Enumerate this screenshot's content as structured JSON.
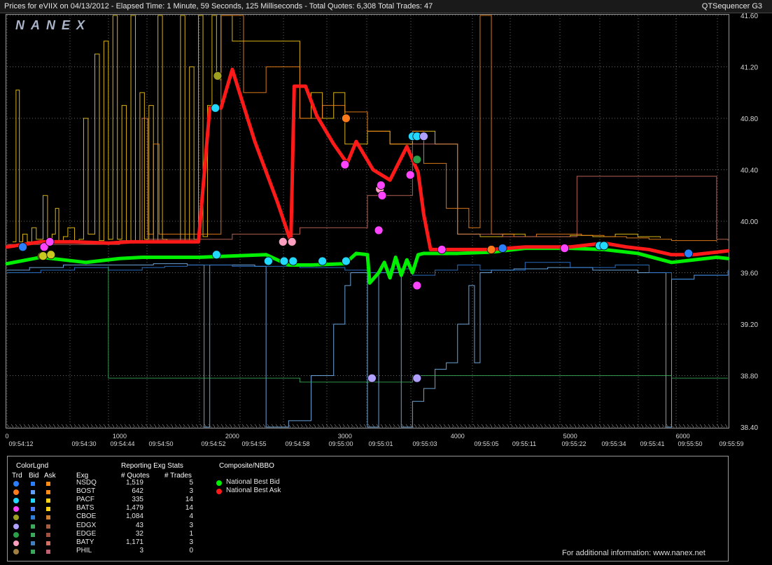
{
  "header": {
    "title": "Prices for  eVIIX  on  04/13/2012  -  Elapsed Time: 1 Minute, 59 Seconds, 125 Milliseconds  -  Total Quotes: 6,308  Total Trades: 47",
    "product": "QTSequencer G3",
    "watermark": "NANEX"
  },
  "chart_data": {
    "type": "line",
    "title": "",
    "ylim": [
      38.4,
      41.6
    ],
    "y_ticks": [
      "41.60",
      "41.20",
      "40.80",
      "40.40",
      "40.00",
      "39.60",
      "39.20",
      "38.80",
      "38.40"
    ],
    "xlim": [
      0,
      6400
    ],
    "x_ticks": [
      "0",
      "1000",
      "2000",
      "3000",
      "4000",
      "5000",
      "6000"
    ],
    "time_labels": [
      "09:54:12",
      "09:54:30",
      "09:54:44",
      "09:54:50",
      "09:54:52",
      "09:54:55",
      "09:54:58",
      "09:55:00",
      "09:55:01",
      "09:55:03",
      "09:55:05",
      "09:55:11",
      "09:55:22",
      "09:55:34",
      "09:55:41",
      "09:55:50",
      "09:55:59"
    ],
    "grid": true,
    "series": [
      {
        "name": "National Best Bid",
        "color": "#00ee00",
        "x": [
          0,
          300,
          700,
          1000,
          1200,
          1400,
          1700,
          2000,
          2300,
          2500,
          2700,
          3000,
          3100,
          3200,
          3220,
          3300,
          3350,
          3400,
          3450,
          3500,
          3550,
          3600,
          3650,
          3700,
          3800,
          4000,
          4300,
          4600,
          5000,
          5300,
          5600,
          5900,
          6100,
          6300,
          6400
        ],
        "y": [
          39.67,
          39.72,
          39.68,
          39.71,
          39.72,
          39.72,
          39.72,
          39.73,
          39.74,
          39.66,
          39.66,
          39.67,
          39.75,
          39.74,
          39.52,
          39.6,
          39.68,
          39.56,
          39.72,
          39.58,
          39.7,
          39.6,
          39.74,
          39.75,
          39.75,
          39.75,
          39.76,
          39.79,
          39.79,
          39.78,
          39.75,
          39.68,
          39.7,
          39.72,
          39.71
        ]
      },
      {
        "name": "National Best Ask",
        "color": "#ff1a1a",
        "x": [
          0,
          300,
          600,
          900,
          1100,
          1400,
          1700,
          1800,
          1900,
          2000,
          2200,
          2400,
          2520,
          2550,
          2650,
          2750,
          2900,
          3020,
          3100,
          3250,
          3400,
          3550,
          3650,
          3700,
          3760,
          3800,
          3900,
          4300,
          4600,
          5000,
          5300,
          5500,
          5700,
          5900,
          6100,
          6300,
          6400
        ],
        "y": [
          39.8,
          39.84,
          39.84,
          39.83,
          39.84,
          39.84,
          39.84,
          40.88,
          40.88,
          41.18,
          40.62,
          40.15,
          39.84,
          41.05,
          41.05,
          40.82,
          40.6,
          40.45,
          40.62,
          40.4,
          40.32,
          40.58,
          40.38,
          40.05,
          39.78,
          39.78,
          39.78,
          39.78,
          39.8,
          39.8,
          39.83,
          39.8,
          39.78,
          39.74,
          39.74,
          39.76,
          39.77
        ]
      }
    ],
    "trade_markers": [
      {
        "x": 140,
        "y": 39.8,
        "color": "#2a7fff"
      },
      {
        "x": 310,
        "y": 39.73,
        "color": "#c8c820"
      },
      {
        "x": 320,
        "y": 39.73,
        "color": "#c8c820"
      },
      {
        "x": 330,
        "y": 39.8,
        "color": "#ff44ff"
      },
      {
        "x": 380,
        "y": 39.84,
        "color": "#ff44ff"
      },
      {
        "x": 390,
        "y": 39.74,
        "color": "#c8c820"
      },
      {
        "x": 1850,
        "y": 40.88,
        "color": "#22d8ff"
      },
      {
        "x": 1870,
        "y": 41.13,
        "color": "#a0a020"
      },
      {
        "x": 1860,
        "y": 39.74,
        "color": "#22d8ff"
      },
      {
        "x": 2320,
        "y": 39.69,
        "color": "#22d8ff"
      },
      {
        "x": 2450,
        "y": 39.84,
        "color": "#ff9fbf"
      },
      {
        "x": 2530,
        "y": 39.84,
        "color": "#ff9fbf"
      },
      {
        "x": 2460,
        "y": 39.69,
        "color": "#22d8ff"
      },
      {
        "x": 2540,
        "y": 39.69,
        "color": "#22d8ff"
      },
      {
        "x": 2800,
        "y": 39.69,
        "color": "#22d8ff"
      },
      {
        "x": 3000,
        "y": 40.44,
        "color": "#ff44ff"
      },
      {
        "x": 3010,
        "y": 40.8,
        "color": "#ff7a1a"
      },
      {
        "x": 3010,
        "y": 39.69,
        "color": "#22d8ff"
      },
      {
        "x": 3240,
        "y": 38.78,
        "color": "#b0a0ff"
      },
      {
        "x": 3300,
        "y": 39.93,
        "color": "#ff44ff"
      },
      {
        "x": 3310,
        "y": 40.25,
        "color": "#ff9fbf"
      },
      {
        "x": 3320,
        "y": 40.28,
        "color": "#ff44ff"
      },
      {
        "x": 3330,
        "y": 40.2,
        "color": "#ff44ff"
      },
      {
        "x": 3580,
        "y": 40.36,
        "color": "#ff44ff"
      },
      {
        "x": 3600,
        "y": 40.66,
        "color": "#22d8ff"
      },
      {
        "x": 3640,
        "y": 40.66,
        "color": "#22d8ff"
      },
      {
        "x": 3640,
        "y": 40.48,
        "color": "#2a9f4a"
      },
      {
        "x": 3700,
        "y": 40.66,
        "color": "#b0a0ff"
      },
      {
        "x": 3640,
        "y": 38.78,
        "color": "#b0a0ff"
      },
      {
        "x": 3640,
        "y": 39.5,
        "color": "#ff44ff"
      },
      {
        "x": 3860,
        "y": 39.78,
        "color": "#ff44ff"
      },
      {
        "x": 4300,
        "y": 39.78,
        "color": "#ff7a1a"
      },
      {
        "x": 4400,
        "y": 39.79,
        "color": "#2a7fff"
      },
      {
        "x": 4950,
        "y": 39.79,
        "color": "#ff44ff"
      },
      {
        "x": 5260,
        "y": 39.81,
        "color": "#22d8ff"
      },
      {
        "x": 5300,
        "y": 39.81,
        "color": "#22d8ff"
      },
      {
        "x": 6050,
        "y": 39.75,
        "color": "#2a7fff"
      }
    ],
    "noise_lines": [
      {
        "color": "#ffd21a",
        "x": [
          50,
          80,
          80,
          110,
          140,
          180,
          220,
          260,
          320,
          360,
          400,
          430,
          460,
          500,
          540,
          600,
          640,
          680,
          720,
          780,
          820,
          860,
          900,
          940,
          980,
          1020,
          1060,
          1100,
          1140,
          1180,
          1220,
          1260,
          1300,
          1340,
          1380,
          1420
        ],
        "y": [
          39.84,
          39.84,
          41.02,
          39.84,
          39.9,
          39.84,
          39.95,
          39.86,
          40.2,
          39.85,
          39.9,
          40.1,
          39.85,
          39.88,
          39.95,
          39.84,
          39.86,
          40.8,
          39.9,
          41.3,
          39.85,
          41.4,
          39.86,
          41.6,
          39.86,
          40.9,
          39.85,
          41.6,
          39.84,
          41.0,
          39.86,
          40.9,
          39.84,
          41.6,
          39.86,
          39.84
        ]
      },
      {
        "color": "#ffd21a",
        "x": [
          1500,
          1540,
          1580,
          1620,
          1660,
          1700,
          1740,
          1780,
          1820,
          1860,
          1900,
          2000,
          2500,
          2600,
          2700,
          2800,
          2900,
          3000,
          3200,
          3400,
          3600,
          3800,
          4000,
          4200,
          4400,
          4600,
          4800,
          5000,
          5200,
          5400,
          5600,
          5800
        ],
        "y": [
          39.85,
          41.6,
          39.85,
          41.2,
          39.86,
          41.6,
          39.88,
          40.9,
          41.6,
          41.1,
          41.6,
          41.4,
          41.4,
          40.8,
          41.0,
          40.8,
          41.0,
          40.6,
          40.7,
          40.6,
          40.7,
          40.6,
          39.9,
          39.88,
          39.9,
          39.88,
          39.88,
          39.89,
          39.88,
          39.9,
          39.88,
          39.87
        ]
      },
      {
        "color": "#ff8c1a",
        "x": [
          1200,
          1250,
          1300,
          1350,
          1900,
          2100,
          2300,
          2500,
          2600,
          2800,
          3000,
          3200,
          3400,
          3600,
          3700,
          3900,
          4100,
          4200,
          4300,
          4500,
          4700,
          4900,
          5100,
          5300,
          5500,
          5700,
          5900,
          6100,
          6300
        ],
        "y": [
          40.8,
          39.9,
          40.6,
          39.9,
          41.6,
          41.0,
          41.2,
          41.2,
          40.8,
          40.9,
          40.85,
          40.7,
          40.6,
          40.7,
          40.45,
          40.1,
          39.95,
          41.6,
          39.9,
          39.88,
          39.9,
          39.9,
          39.89,
          39.88,
          39.87,
          39.86,
          39.85,
          39.85,
          39.84
        ]
      },
      {
        "color": "#d07060",
        "x": [
          0,
          500,
          1000,
          1200,
          1250,
          2000,
          2600,
          3200,
          3600,
          4000,
          4400,
          5000,
          5060,
          5400,
          5800,
          6100,
          6300,
          6400
        ],
        "y": [
          39.82,
          39.82,
          39.85,
          40.8,
          39.86,
          39.9,
          39.95,
          40.2,
          40.6,
          39.9,
          39.88,
          39.88,
          40.35,
          40.35,
          40.35,
          40.35,
          39.86,
          39.85
        ]
      },
      {
        "color": "#7cc0ff",
        "x": [
          0,
          200,
          500,
          900,
          1300,
          1600,
          1750,
          1800,
          2200,
          2300,
          2500,
          2700,
          2900,
          3000,
          3050,
          3200,
          3300,
          3500,
          3600,
          3700,
          3800,
          3900,
          4000,
          4100,
          4150,
          4200,
          4300,
          4500,
          4800,
          5200,
          5600,
          5800,
          5850,
          5900,
          6100,
          6400
        ],
        "y": [
          39.62,
          39.64,
          39.66,
          39.66,
          39.67,
          39.66,
          38.4,
          39.66,
          39.65,
          38.4,
          38.45,
          38.8,
          39.2,
          39.5,
          39.6,
          38.4,
          39.6,
          38.4,
          38.6,
          38.7,
          38.85,
          38.9,
          39.2,
          39.5,
          38.9,
          39.6,
          39.62,
          39.63,
          39.64,
          39.62,
          39.6,
          39.6,
          38.4,
          39.55,
          39.58,
          39.62
        ]
      },
      {
        "color": "#2f7fdf",
        "x": [
          0,
          300,
          600,
          900,
          1200,
          1400,
          1600,
          2000,
          2600,
          3000,
          3200,
          3400,
          3600,
          3800,
          4000,
          4200,
          4600,
          5000,
          5400,
          5700,
          5900,
          6100,
          6400
        ],
        "y": [
          39.6,
          39.62,
          39.64,
          39.62,
          39.64,
          39.65,
          39.66,
          39.65,
          39.64,
          39.62,
          39.6,
          39.63,
          39.58,
          39.62,
          39.66,
          39.62,
          39.68,
          39.64,
          39.66,
          39.6,
          39.55,
          39.58,
          39.62
        ]
      },
      {
        "color": "#3aaa5a",
        "x": [
          900,
          900,
          1600,
          2400,
          2600,
          3300,
          3600,
          4000,
          5900,
          6400
        ],
        "y": [
          39.65,
          38.78,
          38.78,
          38.78,
          38.75,
          38.75,
          38.8,
          38.8,
          38.78,
          38.78
        ]
      }
    ]
  },
  "legend": {
    "colorlgnd_title": "ColorLgnd",
    "col_trd": "Trd",
    "col_bid": "Bid",
    "col_ask": "Ask",
    "col_exg": "Exg",
    "stats_title": "Reporting Exg Stats",
    "col_quotes": "# Quotes",
    "col_trades": "# Trades",
    "nbbo_title": "Composite/NBBO",
    "nbbo_bid": "National Best Bid",
    "nbbo_ask": "National Best Ask",
    "nbbo_bid_color": "#00ee00",
    "nbbo_ask_color": "#ff1a1a",
    "rows": [
      {
        "exg": "NSDQ",
        "quotes": "1,519",
        "trades": "5",
        "trd": "#2a7fff",
        "bid": "#2a7fff",
        "ask": "#ff8c1a"
      },
      {
        "exg": "BOST",
        "quotes": "642",
        "trades": "3",
        "trd": "#ff7a1a",
        "bid": "#5fa0ff",
        "ask": "#ff8c1a"
      },
      {
        "exg": "PACF",
        "quotes": "335",
        "trades": "14",
        "trd": "#22d8ff",
        "bid": "#22d8ff",
        "ask": "#ffd21a"
      },
      {
        "exg": "BATS",
        "quotes": "1,479",
        "trades": "14",
        "trd": "#ff44ff",
        "bid": "#4d7fff",
        "ask": "#ffd21a"
      },
      {
        "exg": "CBOE",
        "quotes": "1,084",
        "trades": "4",
        "trd": "#a0a020",
        "bid": "#2f7fdf",
        "ask": "#d08030"
      },
      {
        "exg": "EDGX",
        "quotes": "43",
        "trades": "3",
        "trd": "#b0a0ff",
        "bid": "#3aaa5a",
        "ask": "#a06040"
      },
      {
        "exg": "EDGE",
        "quotes": "32",
        "trades": "1",
        "trd": "#2a9f4a",
        "bid": "#3aaa5a",
        "ask": "#a05040"
      },
      {
        "exg": "BATY",
        "quotes": "1,171",
        "trades": "3",
        "trd": "#ff9fbf",
        "bid": "#3f7fbf",
        "ask": "#d07060"
      },
      {
        "exg": "PHIL",
        "quotes": "3",
        "trades": "0",
        "trd": "#a08040",
        "bid": "#3aaa5a",
        "ask": "#c06070"
      }
    ]
  },
  "footer": {
    "info": "For additional information: www.nanex.net"
  }
}
